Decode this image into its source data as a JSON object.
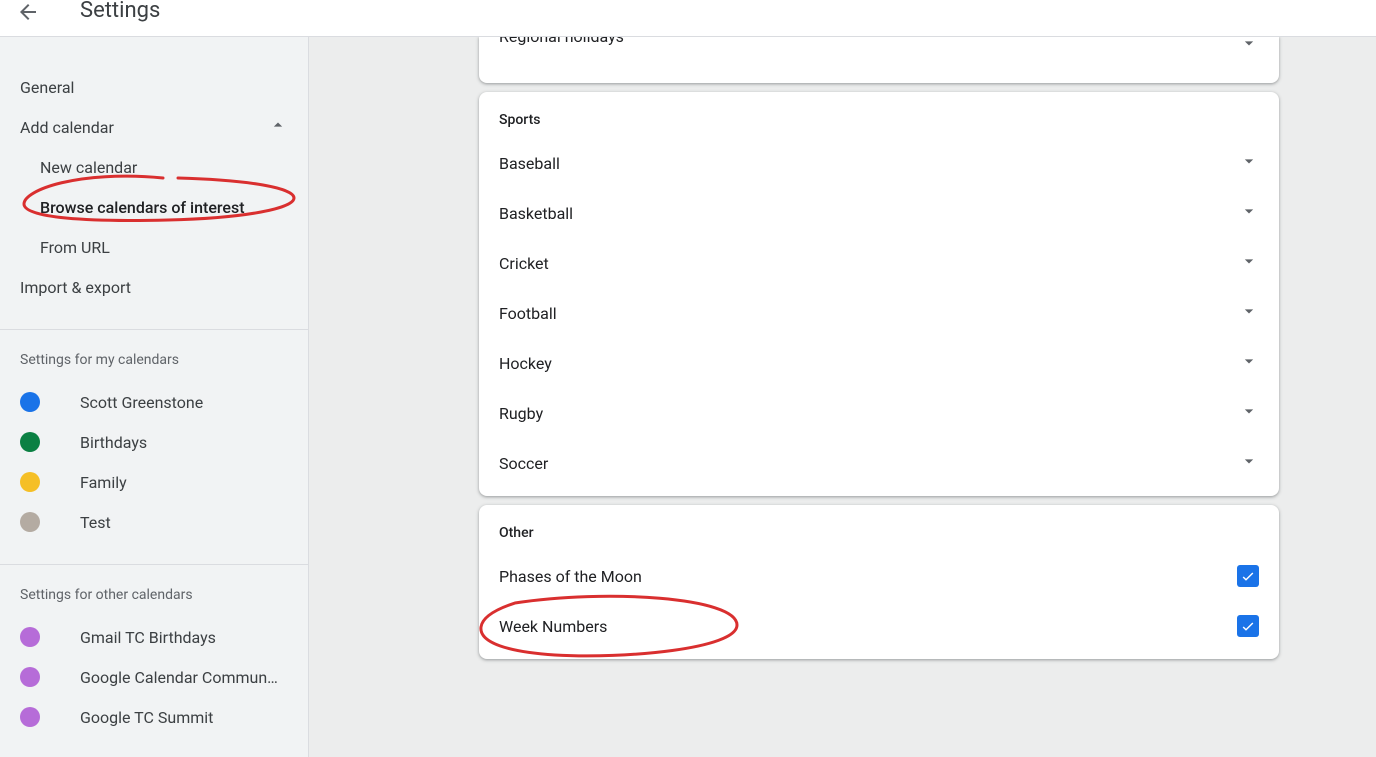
{
  "header": {
    "title": "Settings"
  },
  "sidebar": {
    "general": "General",
    "add_calendar": "Add calendar",
    "add_calendar_children": {
      "new_calendar": "New calendar",
      "browse": "Browse calendars of interest",
      "from_url": "From URL"
    },
    "import_export": "Import & export",
    "settings_my_label": "Settings for my calendars",
    "my_calendars": [
      {
        "name": "Scott Greenstone",
        "color": "#1a73e8"
      },
      {
        "name": "Birthdays",
        "color": "#0b8043"
      },
      {
        "name": "Family",
        "color": "#f5bf26"
      },
      {
        "name": "Test",
        "color": "#b4aba2"
      }
    ],
    "settings_other_label": "Settings for other calendars",
    "other_calendars": [
      {
        "name": "Gmail TC Birthdays",
        "color": "#b66cd8"
      },
      {
        "name": "Google Calendar Commun…",
        "color": "#b66cd8"
      },
      {
        "name": "Google TC Summit",
        "color": "#b66cd8"
      }
    ]
  },
  "main": {
    "truncated_row": "Regional holidays",
    "sports": {
      "header": "Sports",
      "items": [
        "Baseball",
        "Basketball",
        "Cricket",
        "Football",
        "Hockey",
        "Rugby",
        "Soccer"
      ]
    },
    "other": {
      "header": "Other",
      "items": [
        {
          "label": "Phases of the Moon",
          "checked": true
        },
        {
          "label": "Week Numbers",
          "checked": true
        }
      ]
    }
  }
}
